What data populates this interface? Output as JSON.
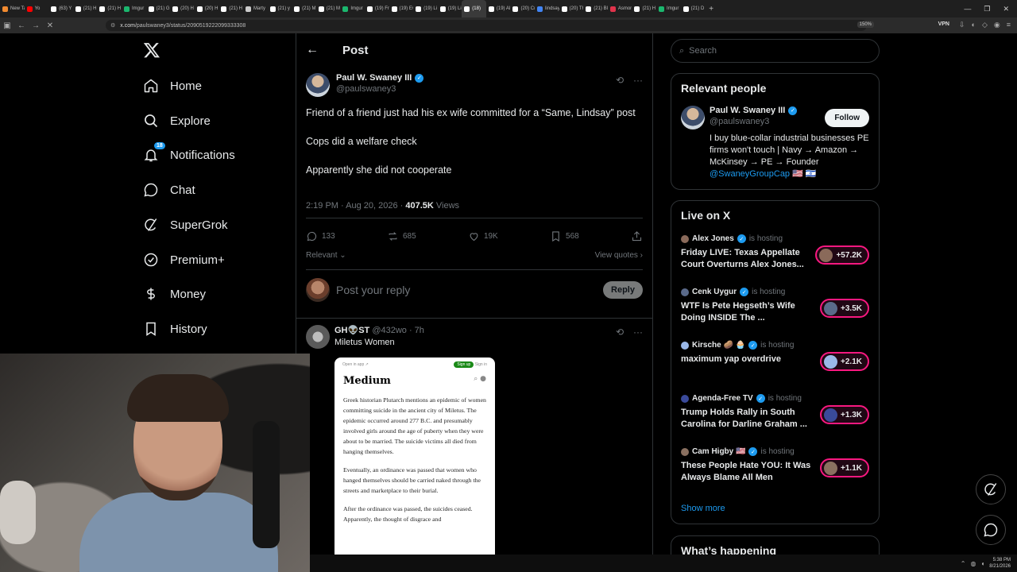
{
  "browser": {
    "tabs": [
      {
        "label": "New Ta",
        "color": "#f28b30"
      },
      {
        "label": "Yo",
        "color": "#ff0000"
      },
      {
        "label": "(63) Y",
        "color": "#ffffff"
      },
      {
        "label": "(21) H",
        "color": "#ffffff"
      },
      {
        "label": "(21) H",
        "color": "#ffffff"
      },
      {
        "label": "Imgur",
        "color": "#1bb76e"
      },
      {
        "label": "(21) G",
        "color": "#ffffff"
      },
      {
        "label": "(20) H",
        "color": "#ffffff"
      },
      {
        "label": "(20) H",
        "color": "#ffffff"
      },
      {
        "label": "(21) H",
        "color": "#ffffff"
      },
      {
        "label": "Marty",
        "color": "#cccccc"
      },
      {
        "label": "(21) y",
        "color": "#ffffff"
      },
      {
        "label": "(21) M",
        "color": "#ffffff"
      },
      {
        "label": "(21) M",
        "color": "#ffffff"
      },
      {
        "label": "Imgur",
        "color": "#1bb76e"
      },
      {
        "label": "(19) Fr",
        "color": "#ffffff"
      },
      {
        "label": "(19) Ev",
        "color": "#ffffff"
      },
      {
        "label": "(19) Li",
        "color": "#ffffff"
      },
      {
        "label": "(19) Li",
        "color": "#ffffff"
      },
      {
        "label": "(18)",
        "color": "#ffffff",
        "active": true
      },
      {
        "label": "(19) Al",
        "color": "#ffffff"
      },
      {
        "label": "(20) Cr",
        "color": "#ffffff"
      },
      {
        "label": "lindsay",
        "color": "#4285f4"
      },
      {
        "label": "(20) Th",
        "color": "#ffffff"
      },
      {
        "label": "(21) Bl",
        "color": "#ffffff"
      },
      {
        "label": "Asmon",
        "color": "#e0334b"
      },
      {
        "label": "(21) H",
        "color": "#ffffff"
      },
      {
        "label": "Imgur",
        "color": "#1bb76e"
      },
      {
        "label": "(21) D",
        "color": "#ffffff"
      }
    ],
    "url_host": "x.com",
    "url_path": "/paulswaney3/status/2090519222099333308",
    "zoom": "150%",
    "vpn_label": "VPN"
  },
  "nav": {
    "logo": "x-logo",
    "items": [
      {
        "label": "Home",
        "icon": "home-icon"
      },
      {
        "label": "Explore",
        "icon": "search-icon"
      },
      {
        "label": "Notifications",
        "icon": "bell-icon",
        "badge": "18"
      },
      {
        "label": "Chat",
        "icon": "chat-icon"
      },
      {
        "label": "SuperGrok",
        "icon": "grok-icon"
      },
      {
        "label": "Premium+",
        "icon": "premium-icon"
      },
      {
        "label": "Money",
        "icon": "money-icon"
      },
      {
        "label": "History",
        "icon": "bookmark-icon"
      }
    ]
  },
  "post": {
    "header_title": "Post",
    "author_name": "Paul W. Swaney III",
    "author_handle": "@paulswaney3",
    "paragraphs": [
      "Friend of a friend just had his ex wife committed for a “Same, Lindsay” post",
      "Cops did a welfare check",
      "Apparently she did not cooperate"
    ],
    "time": "2:19 PM · Aug 20, 2026 · ",
    "views_count": "407.5K",
    "views_label": " Views",
    "stats": {
      "replies": "133",
      "reposts": "685",
      "likes": "19K",
      "bookmarks": "568"
    },
    "sort_label": "Relevant",
    "view_quotes": "View quotes",
    "reply_placeholder": "Post your reply",
    "reply_button": "Reply"
  },
  "reply": {
    "name": "GH👽ST",
    "meta": " @432wo · 7h",
    "text": "Miletus Women",
    "card": {
      "open_in_app": "Open in app ↗",
      "signup": "Sign up",
      "signin": "Sign in",
      "brand": "Medium",
      "paragraphs": [
        "Greek historian Plutarch mentions an epidemic of women committing suicide in the ancient city of Miletus. The epidemic occurred around 277 B.C. and presumably involved girls around the age of puberty when they were about to be married. The suicide victims all died from hanging themselves.",
        "Eventually, an ordinance was passed that women who hanged themselves should be carried naked through the streets and marketplace to their burial.",
        "After the ordinance was passed, the suicides ceased. Apparently, the thought of disgrace and"
      ]
    }
  },
  "right": {
    "search_placeholder": "Search",
    "relevant_title": "Relevant people",
    "person": {
      "name": "Paul W. Swaney III",
      "handle": "@paulswaney3",
      "follow": "Follow",
      "bio": "I buy blue-collar industrial businesses PE firms won't touch | Navy → Amazon → McKinsey → PE → Founder",
      "bio_link": "@SwaneyGroupCap",
      "bio_flags": " 🇺🇸 🇮🇱"
    },
    "live_title": "Live on X",
    "live": [
      {
        "host": "Alex Jones",
        "hosting": "is hosting",
        "title": "Friday LIVE: Texas Appellate Court Overturns Alex Jones...",
        "count": "+57.2K",
        "color": "#8a6a5a"
      },
      {
        "host": "Cenk Uygur",
        "hosting": "is hosting",
        "title": "WTF Is Pete Hegseth’s Wife Doing INSIDE The ...",
        "count": "+3.5K",
        "color": "#5a6a8a"
      },
      {
        "host": "Kirsche 🥔 🧁",
        "hosting": "is hosting",
        "title": "maximum yap overdrive",
        "count": "+2.1K",
        "color": "#9ab8e8"
      },
      {
        "host": "Agenda-Free TV",
        "hosting": "is hosting",
        "title": "Trump Holds Rally in South Carolina for Darline Graham ...",
        "count": "+1.3K",
        "color": "#3a4a9a"
      },
      {
        "host": "Cam Higby 🇺🇸",
        "hosting": "is hosting",
        "title": "These People Hate YOU: It Was Always Blame All Men",
        "count": "+1.1K",
        "color": "#8a7060"
      }
    ],
    "show_more": "Show more",
    "whats_happening": "What’s happening"
  },
  "taskbar": {
    "time": "5:38 PM",
    "date": "8/21/2026"
  },
  "colors": {
    "accent": "#1d9bf0",
    "live": "#f91880",
    "bg": "#000000",
    "border": "#2f3336",
    "muted": "#71767b"
  }
}
